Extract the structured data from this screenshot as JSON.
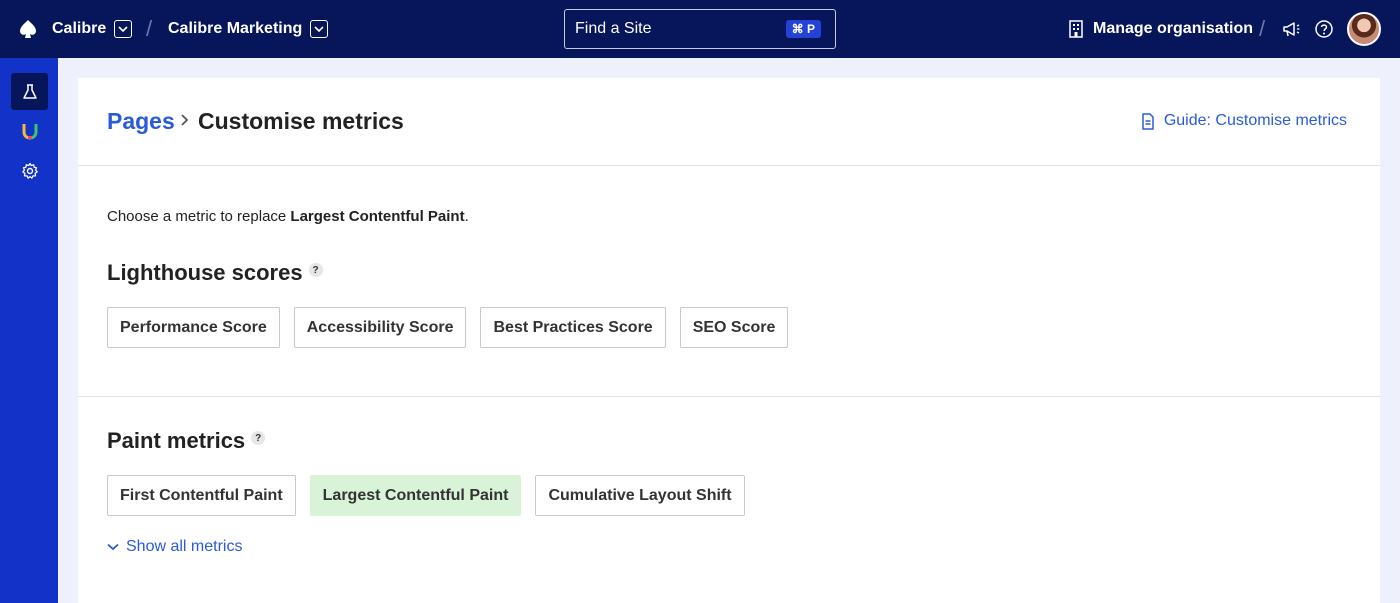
{
  "topbar": {
    "org_name": "Calibre",
    "team_name": "Calibre Marketing",
    "search_placeholder": "Find a Site",
    "search_shortcut": "⌘ P",
    "manage_label": "Manage organisation"
  },
  "breadcrumb": {
    "parent": "Pages",
    "current": "Customise metrics"
  },
  "guide_link": "Guide: Customise metrics",
  "intro": {
    "prefix": "Choose a metric to replace ",
    "metric": "Largest Contentful Paint",
    "suffix": "."
  },
  "sections": {
    "lighthouse": {
      "title": "Lighthouse scores",
      "help": "?",
      "chips": [
        "Performance Score",
        "Accessibility Score",
        "Best Practices Score",
        "SEO Score"
      ]
    },
    "paint": {
      "title": "Paint metrics",
      "help": "?",
      "chips": [
        "First Contentful Paint",
        "Largest Contentful Paint",
        "Cumulative Layout Shift"
      ],
      "selected": "Largest Contentful Paint"
    }
  },
  "show_all": "Show all metrics",
  "colors": {
    "topbar": "#07155a",
    "sidebar": "#1232c8",
    "link": "#2a5bd7",
    "selected_chip": "#d8f3d7"
  },
  "icons": {
    "logo": "calibre-logo-icon",
    "manage": "building-icon",
    "announce": "megaphone-icon",
    "help": "help-circle-icon",
    "sidebar": [
      "flask-icon",
      "horseshoe-icon",
      "gear-icon"
    ]
  }
}
